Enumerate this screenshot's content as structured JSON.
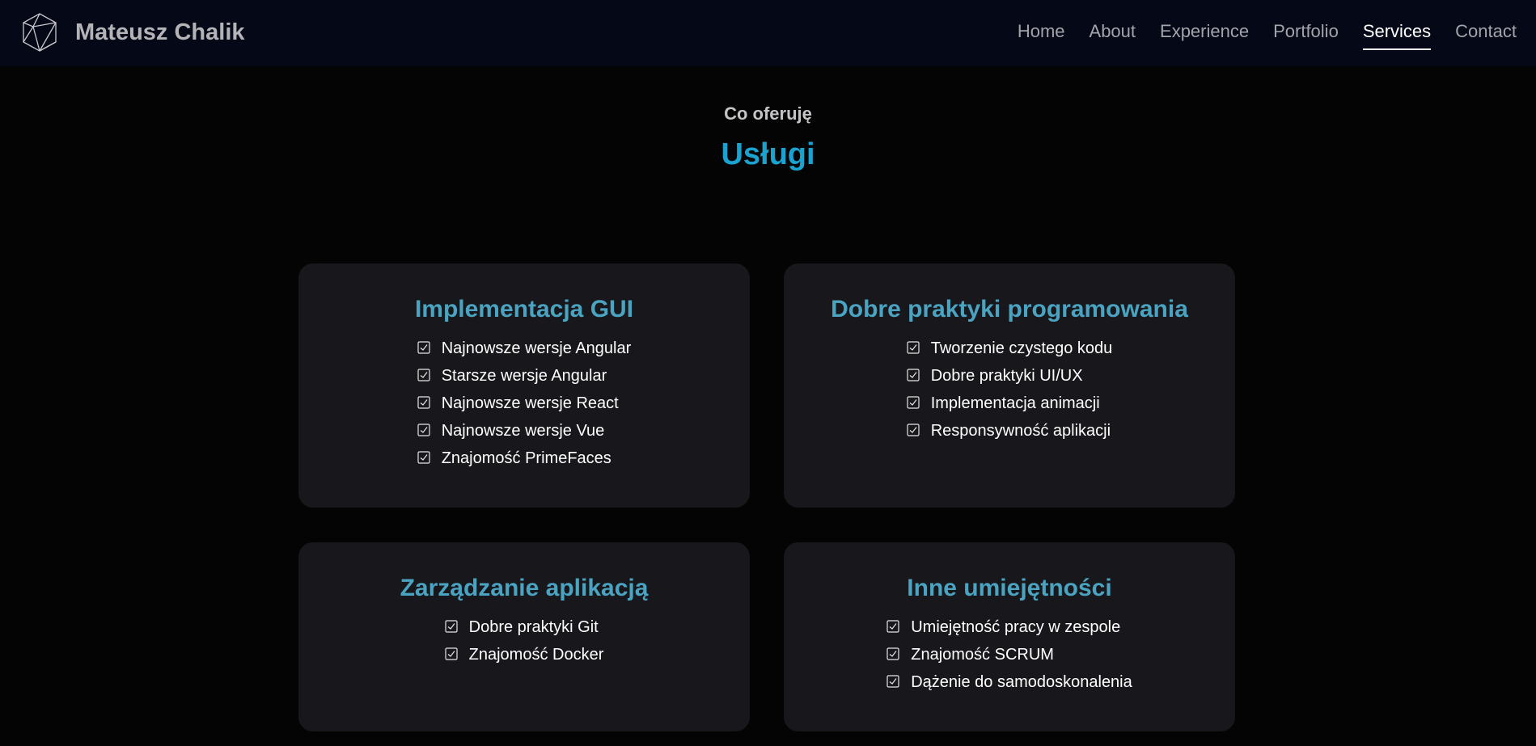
{
  "brand": {
    "name": "Mateusz Chalik",
    "logo_icon": "polyhedron-logo-icon"
  },
  "nav": {
    "items": [
      {
        "label": "Home"
      },
      {
        "label": "About"
      },
      {
        "label": "Experience"
      },
      {
        "label": "Portfolio"
      },
      {
        "label": "Services",
        "active": true
      },
      {
        "label": "Contact"
      }
    ]
  },
  "section": {
    "subtitle": "Co oferuję",
    "title": "Usługi"
  },
  "cards": [
    {
      "title": "Implementacja GUI",
      "items": [
        "Najnowsze wersje Angular",
        "Starsze wersje Angular",
        "Najnowsze wersje React",
        "Najnowsze wersje Vue",
        "Znajomość PrimeFaces"
      ]
    },
    {
      "title": "Dobre praktyki programowania",
      "items": [
        "Tworzenie czystego kodu",
        "Dobre praktyki UI/UX",
        "Implementacja animacji",
        "Responsywność aplikacji"
      ]
    },
    {
      "title": "Zarządzanie aplikacją",
      "items": [
        "Dobre praktyki Git",
        "Znajomość Docker"
      ]
    },
    {
      "title": "Inne umiejętności",
      "items": [
        "Umiejętność pracy w zespole",
        "Znajomość SCRUM",
        "Dążenie do samodoskonalenia"
      ]
    }
  ],
  "colors": {
    "accent": "#1aa2d0",
    "card_title": "#4aa3c0",
    "nav_bg": "#050816",
    "card_bg": "#18181c"
  },
  "icons": {
    "check": "checkbox-checked-icon"
  }
}
